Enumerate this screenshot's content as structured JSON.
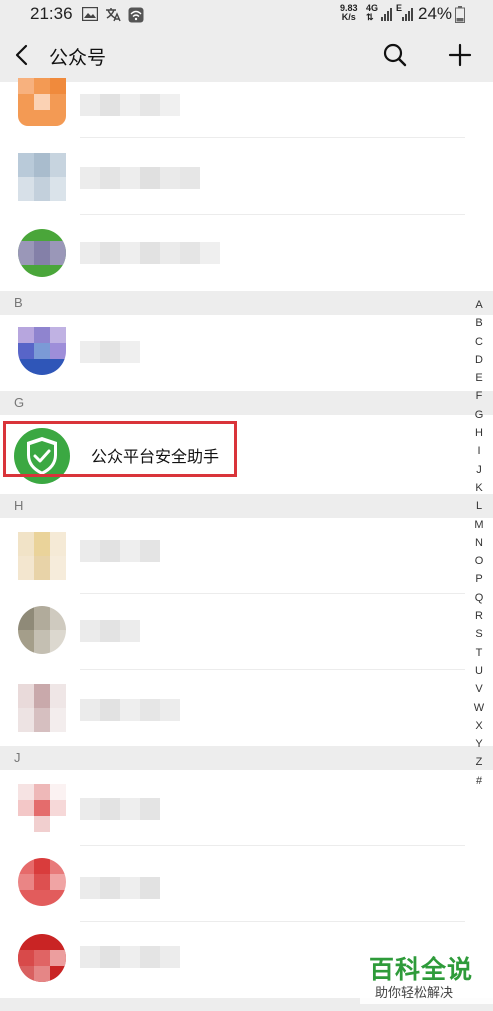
{
  "status_bar": {
    "time": "21:36",
    "net_speed_value": "9.83",
    "net_speed_unit": "K/s",
    "network_type_top": "4G",
    "network_type_bottom": "E",
    "battery": "24%"
  },
  "nav": {
    "title": "公众号"
  },
  "sections": [
    {
      "letter": "B"
    },
    {
      "letter": "G"
    },
    {
      "letter": "H"
    },
    {
      "letter": "J"
    }
  ],
  "highlighted_item": {
    "name": "公众平台安全助手"
  },
  "index_letters": [
    "A",
    "B",
    "C",
    "D",
    "E",
    "F",
    "G",
    "H",
    "I",
    "J",
    "K",
    "L",
    "M",
    "N",
    "O",
    "P",
    "Q",
    "R",
    "S",
    "T",
    "U",
    "V",
    "W",
    "X",
    "Y",
    "Z",
    "#"
  ],
  "watermark": {
    "title": "百科全说",
    "subtitle": "助你轻松解决"
  },
  "colors": {
    "accent_green": "#2e9b3a",
    "highlight_red": "#d9343a",
    "header_bg": "#ededed"
  }
}
